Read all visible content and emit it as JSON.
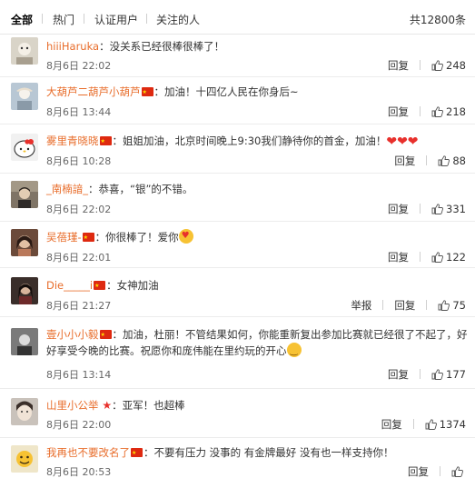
{
  "tabs": [
    "全部",
    "热门",
    "认证用户",
    "关注的人"
  ],
  "total": "共12800条",
  "reply_label": "回复",
  "report_label": "举报",
  "comments": [
    {
      "user": "hiiiHaruka",
      "flag": false,
      "text": "：没关系已经很棒很棒了！",
      "time": "8月6日 22:02",
      "likes": "248",
      "has_report": false,
      "avatar_color": "#d9d4c8"
    },
    {
      "user": "大葫芦二葫芦小葫芦",
      "flag": true,
      "text": "：加油！十四亿人民在你身后~",
      "time": "8月6日 13:44",
      "likes": "218",
      "has_report": false,
      "avatar_color": "#b8c7d4"
    },
    {
      "user": "雾里青晓晓",
      "flag": true,
      "text": "：姐姐加油，北京时间晚上9:30我们静待你的首金，加油！",
      "time": "8月6日 10:28",
      "likes": "88",
      "has_report": false,
      "avatar_color": "#f1f1f1"
    },
    {
      "user": "_南楠諳_",
      "flag": false,
      "text": "：恭喜，“银”的不错。",
      "time": "8月6日 22:02",
      "likes": "331",
      "has_report": false,
      "avatar_color": "#7f7466"
    },
    {
      "user": "吴蓓瑾-",
      "flag": true,
      "text": "：你很棒了！爱你",
      "time": "8月6日 22:01",
      "likes": "122",
      "has_report": false,
      "avatar_color": "#6b4a3a"
    },
    {
      "user": "Die_____i",
      "flag": true,
      "text": "：女神加油",
      "time": "8月6日 21:27",
      "likes": "75",
      "has_report": true,
      "avatar_color": "#3a2e2a"
    },
    {
      "user": "壹小小小毅",
      "flag": true,
      "text": "：加油，杜丽！不管结果如何，你能重新复出参加比赛就已经很了不起了，好好享受今晚的比赛。祝愿你和庞伟能在里约玩的开心",
      "time": "8月6日 13:14",
      "likes": "177",
      "has_report": false,
      "avatar_color": "#5a5a5a"
    },
    {
      "user": "山里小公举",
      "flag": false,
      "text": "：亚军！也超棒",
      "time": "8月6日 22:00",
      "likes": "1374",
      "has_report": false,
      "avatar_color": "#c9c2bb"
    },
    {
      "user": "我再也不要改名了",
      "flag": true,
      "text": "：不要有压力 没事的 有金牌最好 没有也一样支持你！",
      "time": "8月6日 20:53",
      "likes": "",
      "has_report": false,
      "avatar_color": "#efe6c9"
    }
  ]
}
